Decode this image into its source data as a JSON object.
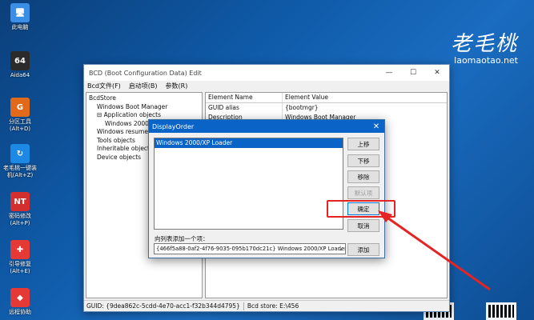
{
  "desktop": {
    "icons": [
      {
        "label": "此电脑",
        "glyph": "🖥"
      },
      {
        "label": "Aida64",
        "glyph": "64"
      },
      {
        "label": "分区工具\n(Alt+D)",
        "glyph": "G"
      },
      {
        "label": "老毛桃一键装\n机(Alt+Z)",
        "glyph": "↻"
      },
      {
        "label": "密码修改\n(Alt+P)",
        "glyph": "NT"
      },
      {
        "label": "引导修复\n(Alt+E)",
        "glyph": "✚"
      },
      {
        "label": "远程协助",
        "glyph": "◆"
      }
    ],
    "brand_title": "老毛桃",
    "brand_url": "laomaotao.net"
  },
  "window": {
    "title": "BCD (Boot Configuration Data) Edit",
    "menu": [
      "Bcd文件(F)",
      "启动项(B)",
      "参数(R)"
    ],
    "tree": [
      {
        "label": "BcdStore",
        "indent": 0
      },
      {
        "label": "Windows Boot Manager",
        "indent": 1
      },
      {
        "label": "Application objects",
        "indent": 1,
        "prefix": "⊟"
      },
      {
        "label": "Windows 2000/XP Loader",
        "indent": 2
      },
      {
        "label": "Windows resume objects",
        "indent": 1
      },
      {
        "label": "Tools objects",
        "indent": 1
      },
      {
        "label": "Inheritable objects",
        "indent": 1
      },
      {
        "label": "Device objects",
        "indent": 1
      }
    ],
    "grid": {
      "headers": [
        "Element Name",
        "Element Value"
      ],
      "rows": [
        [
          "GUID alias",
          "{bootmgr}"
        ],
        [
          "Description",
          "Windows Boot Manager"
        ]
      ]
    },
    "status": {
      "guid": "GUID: {9dea862c-5cdd-4e70-acc1-f32b344d4795}",
      "store": "Bcd store: E:\\456"
    }
  },
  "dialog": {
    "title": "DisplayOrder",
    "close": "✕",
    "list_items": [
      "Windows 2000/XP Loader"
    ],
    "buttons": {
      "up": "上移",
      "down": "下移",
      "remove": "移除",
      "default": "默认项",
      "ok": "确定",
      "cancel": "取消",
      "add": "添加"
    },
    "add_label": "向列表添加一个项：",
    "combo_value": "{466f5a88-0af2-4f76-9035-095b170dc21c} Windows 2000/XP Loader"
  },
  "colors": {
    "highlight": "#e52323",
    "selection": "#0a64c8"
  }
}
